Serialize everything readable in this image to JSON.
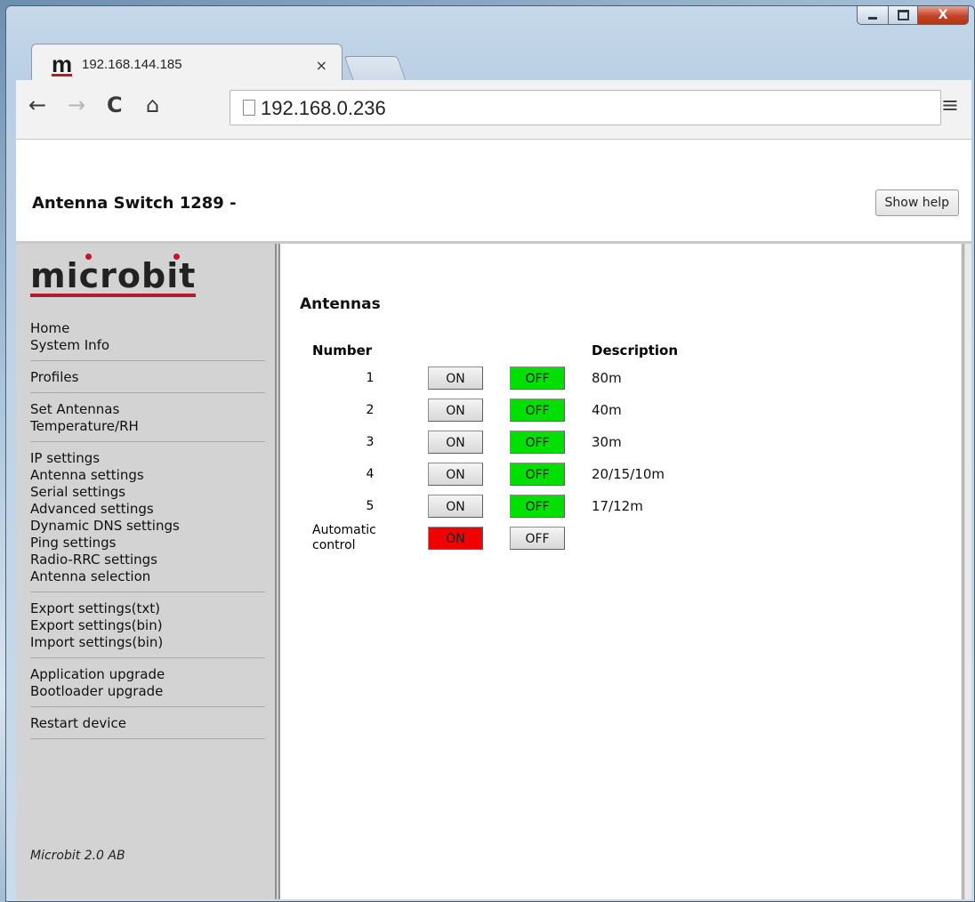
{
  "browser": {
    "tab_title": "192.168.144.185",
    "favicon": "m",
    "tab_close": "×",
    "url": "192.168.0.236",
    "icons": [
      "back-icon",
      "forward-icon",
      "reload-icon",
      "home-icon",
      "page-icon",
      "menu-icon"
    ],
    "window_close": "X"
  },
  "header": {
    "title": "Antenna Switch 1289 -",
    "help_button": "Show help"
  },
  "sidebar": {
    "logo": "microbit",
    "groups": [
      [
        "Home",
        "System Info"
      ],
      [
        "Profiles"
      ],
      [
        "Set Antennas",
        "Temperature/RH"
      ],
      [
        "IP settings",
        "Antenna settings",
        "Serial settings",
        "Advanced settings",
        "Dynamic DNS settings",
        "Ping settings",
        "Radio-RRC settings",
        "Antenna selection"
      ],
      [
        "Export settings(txt)",
        "Export settings(bin)",
        "Import settings(bin)"
      ],
      [
        "Application upgrade",
        "Bootloader upgrade"
      ],
      [
        "Restart device"
      ]
    ],
    "footer": "Microbit 2.0 AB"
  },
  "main": {
    "title": "Antennas",
    "col_number": "Number",
    "col_description": "Description",
    "rows": [
      {
        "number": "1",
        "on": "ON",
        "off": "OFF",
        "description": "80m"
      },
      {
        "number": "2",
        "on": "ON",
        "off": "OFF",
        "description": "40m"
      },
      {
        "number": "3",
        "on": "ON",
        "off": "OFF",
        "description": "30m"
      },
      {
        "number": "4",
        "on": "ON",
        "off": "OFF",
        "description": "20/15/10m"
      },
      {
        "number": "5",
        "on": "ON",
        "off": "OFF",
        "description": "17/12m"
      }
    ],
    "auto": {
      "label_line1": "Automatic",
      "label_line2": "control",
      "on": "ON",
      "off": "OFF"
    },
    "colors": {
      "active_off": "#00e000",
      "active_on": "#f00000"
    }
  }
}
